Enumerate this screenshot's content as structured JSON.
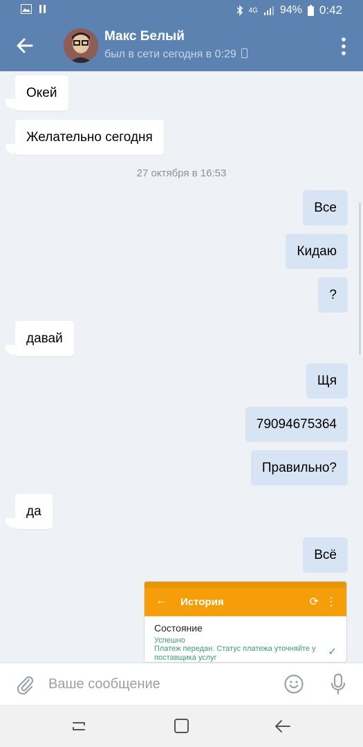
{
  "status_bar": {
    "battery": "94%",
    "time": "0:42",
    "network": "4G",
    "icons": [
      "image-icon",
      "pause-icon",
      "bluetooth-icon",
      "signal-icon",
      "battery-icon"
    ]
  },
  "header": {
    "contact_name": "Макс Белый",
    "contact_status": "был в сети сегодня в 0:29",
    "icons": [
      "back-arrow-icon",
      "avatar",
      "mobile-icon",
      "more-vertical-icon"
    ]
  },
  "chat": {
    "date_separator": "27 октября в 16:53",
    "messages": [
      {
        "dir": "in",
        "text": "Окей"
      },
      {
        "dir": "in",
        "text": "Желательно сегодня"
      },
      {
        "dir": "out",
        "text": "Все"
      },
      {
        "dir": "out",
        "text": "Кидаю"
      },
      {
        "dir": "out",
        "text": "?"
      },
      {
        "dir": "in",
        "text": "давай"
      },
      {
        "dir": "out",
        "text": "Щя"
      },
      {
        "dir": "out",
        "text": "79094675364"
      },
      {
        "dir": "out",
        "text": "Правильно?"
      },
      {
        "dir": "in",
        "text": "да"
      },
      {
        "dir": "out",
        "text": "Всё"
      }
    ],
    "image_message": {
      "header_title": "История",
      "section_title": "Состояние",
      "state": "Успешно",
      "note": "Платеж передан. Статус платежа уточняйте у поставщика услуг",
      "accent_color": "#f59e0a"
    }
  },
  "composer": {
    "placeholder": "Ваше сообщение",
    "value": "",
    "icons": [
      "attach-icon",
      "emoji-icon",
      "mic-icon"
    ]
  },
  "colors": {
    "header_bg": "#5b82b1",
    "chat_bg": "#eef1f5",
    "incoming_bubble": "#ffffff",
    "outgoing_bubble": "#d7e4f3"
  }
}
